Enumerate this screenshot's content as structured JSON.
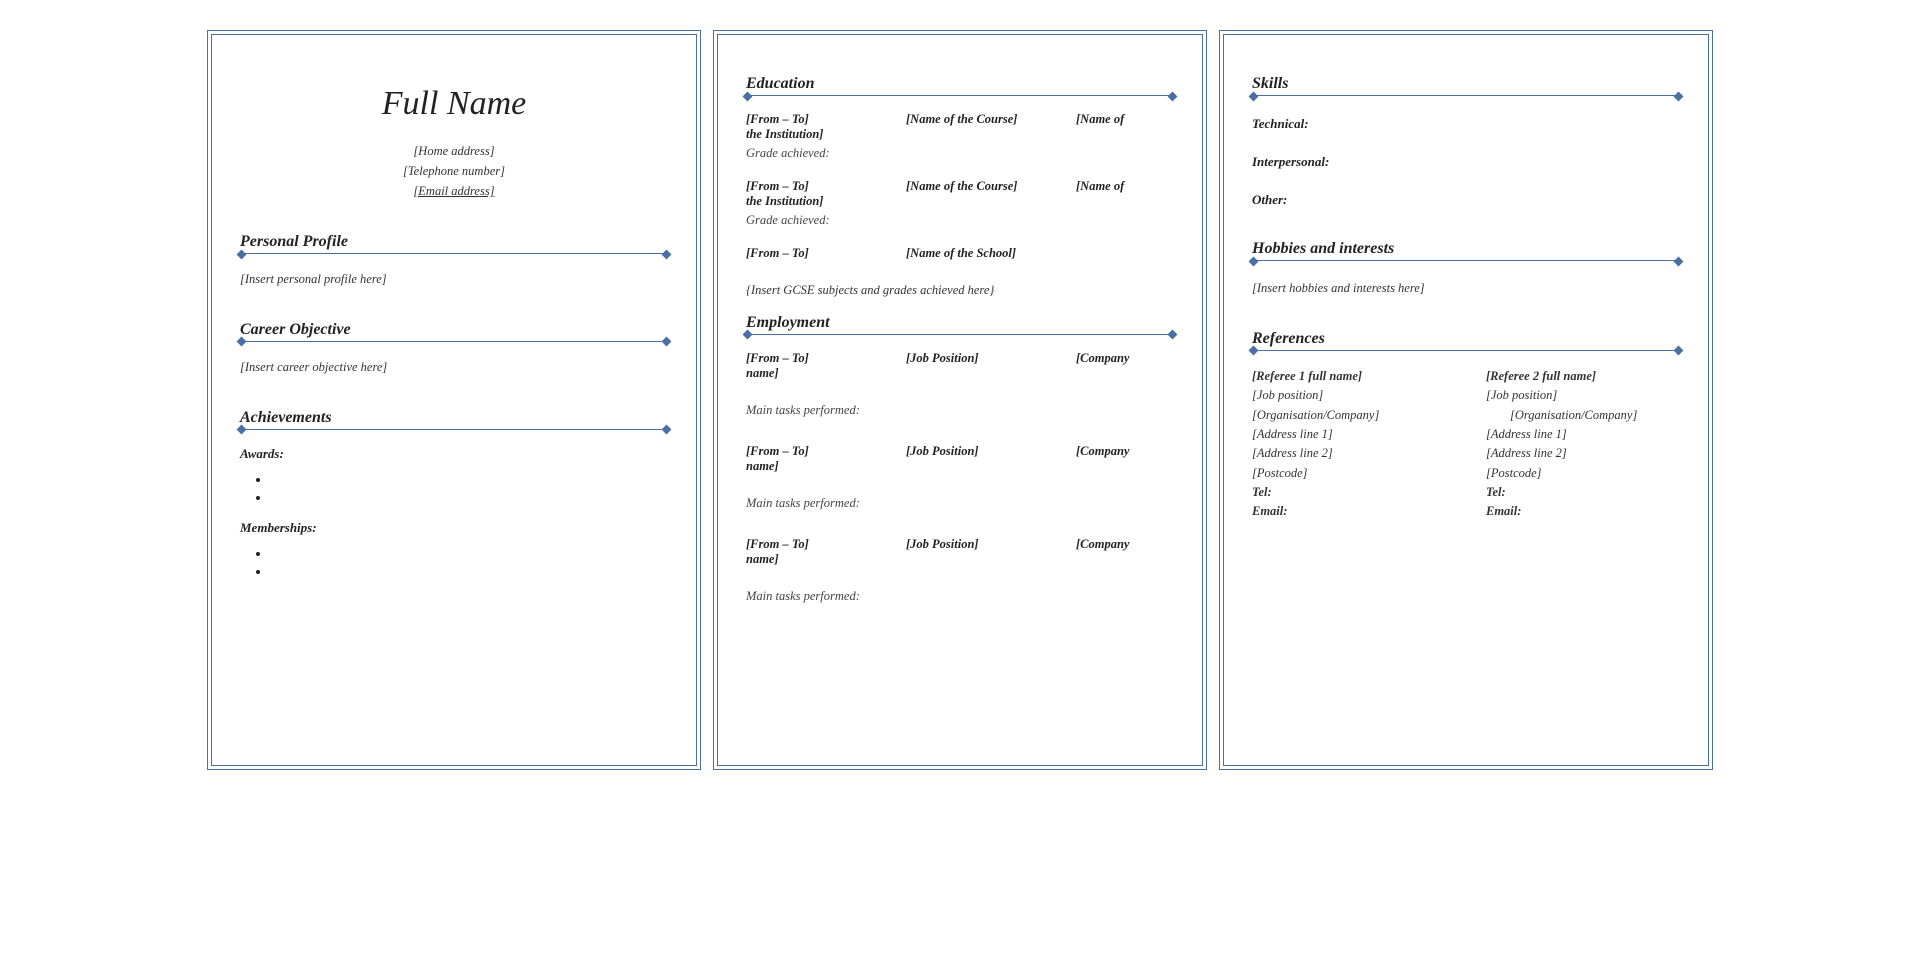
{
  "header": {
    "name": "Full Name",
    "home_address": "[Home address]",
    "telephone": "[Telephone number]",
    "email": "[Email address]"
  },
  "sections": {
    "personal_profile": {
      "title": "Personal Profile",
      "placeholder": "[Insert personal profile here]"
    },
    "career_objective": {
      "title": "Career Objective",
      "placeholder": "[Insert career objective here]"
    },
    "achievements": {
      "title": "Achievements",
      "awards_label": "Awards:",
      "memberships_label": "Memberships:"
    },
    "education": {
      "title": "Education",
      "entries": [
        {
          "dates": "[From – To]",
          "course": "[Name of the Course]",
          "inst_prefix": "[Name of",
          "inst_suffix": "the Institution]",
          "grade_label": "Grade achieved:"
        },
        {
          "dates": "[From – To]",
          "course": "[Name of the Course]",
          "inst_prefix": "[Name of",
          "inst_suffix": "the Institution]",
          "grade_label": "Grade achieved:"
        }
      ],
      "school_row": {
        "dates": "[From – To]",
        "school": "[Name of the School]"
      },
      "gcse_placeholder": "{Insert GCSE subjects and grades achieved here}"
    },
    "employment": {
      "title": "Employment",
      "entries": [
        {
          "dates": "[From – To]",
          "position": "[Job Position]",
          "company_prefix": "[Company",
          "company_suffix": "name]",
          "tasks_label": "Main tasks performed:"
        },
        {
          "dates": "[From – To]",
          "position": "[Job Position]",
          "company_prefix": "[Company",
          "company_suffix": "name]",
          "tasks_label": "Main tasks performed:"
        },
        {
          "dates": "[From – To]",
          "position": "[Job Position]",
          "company_prefix": "[Company",
          "company_suffix": "name]",
          "tasks_label": "Main tasks performed:"
        }
      ]
    },
    "skills": {
      "title": "Skills",
      "technical_label": "Technical:",
      "interpersonal_label": "Interpersonal:",
      "other_label": "Other:"
    },
    "hobbies": {
      "title": "Hobbies and interests",
      "placeholder": "[Insert hobbies and interests here]"
    },
    "references": {
      "title": "References",
      "ref1": {
        "name": "[Referee 1 full name]",
        "position": "[Job position]",
        "org": "[Organisation/Company]",
        "addr1": "[Address line 1]",
        "addr2": "[Address line 2]",
        "postcode": "[Postcode]",
        "tel_label": "Tel:",
        "email_label": "Email:"
      },
      "ref2": {
        "name": "[Referee 2 full name]",
        "position": "[Job position]",
        "org": "[Organisation/Company]",
        "addr1": "[Address line 1]",
        "addr2": "[Address line 2]",
        "postcode": "[Postcode]",
        "tel_label": "Tel:",
        "email_label": "Email:"
      }
    }
  }
}
